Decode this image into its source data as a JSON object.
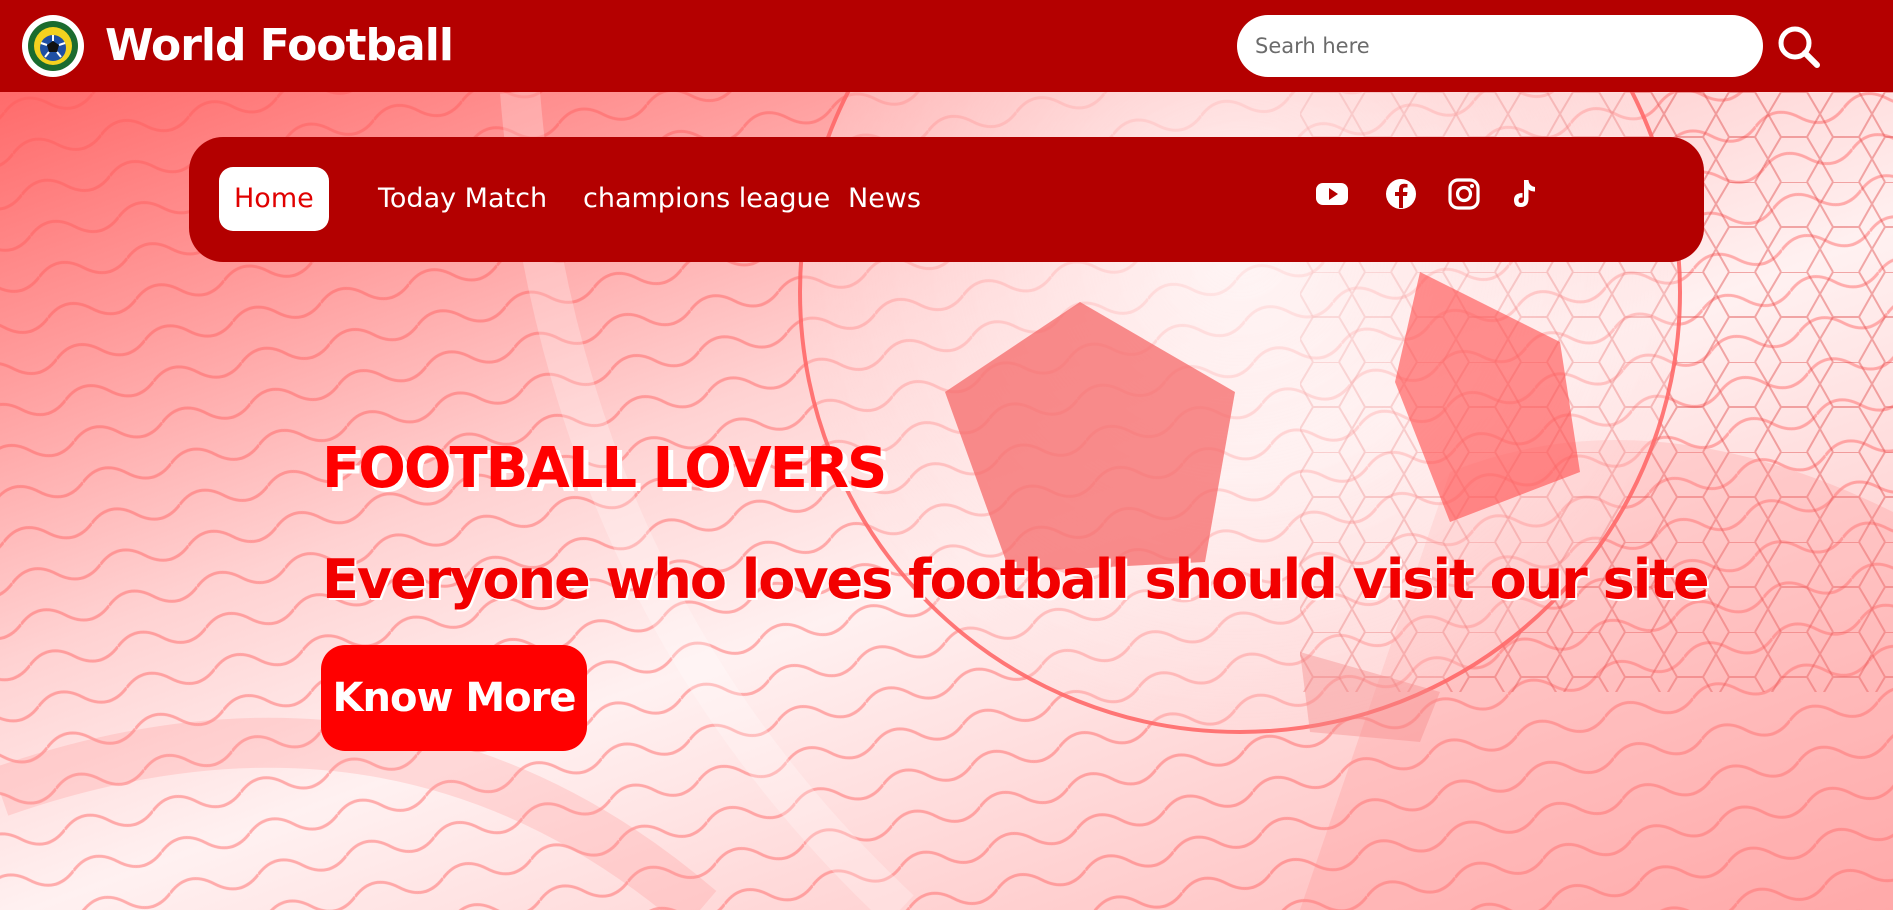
{
  "header": {
    "brand": "World Football",
    "logo_icon": "soccer-ball-icon",
    "search": {
      "placeholder": "Searh here",
      "value": "",
      "icon": "search-icon"
    }
  },
  "nav": {
    "items": [
      {
        "label": "Home",
        "active": true
      },
      {
        "label": "Today Match",
        "active": false
      },
      {
        "label": "champions league",
        "active": false
      },
      {
        "label": "News",
        "active": false
      }
    ],
    "social_icons": [
      "youtube-icon",
      "facebook-icon",
      "instagram-icon",
      "tiktok-icon"
    ]
  },
  "hero": {
    "title": "FOOTBALL LOVERS",
    "subtitle": "Everyone who loves football should visit our site",
    "cta_label": "Know More"
  },
  "colors": {
    "header_bg": "#b40000",
    "nav_bg": "#b30000",
    "accent": "#ff0000",
    "hero_text": "#f20000",
    "white": "#ffffff"
  }
}
